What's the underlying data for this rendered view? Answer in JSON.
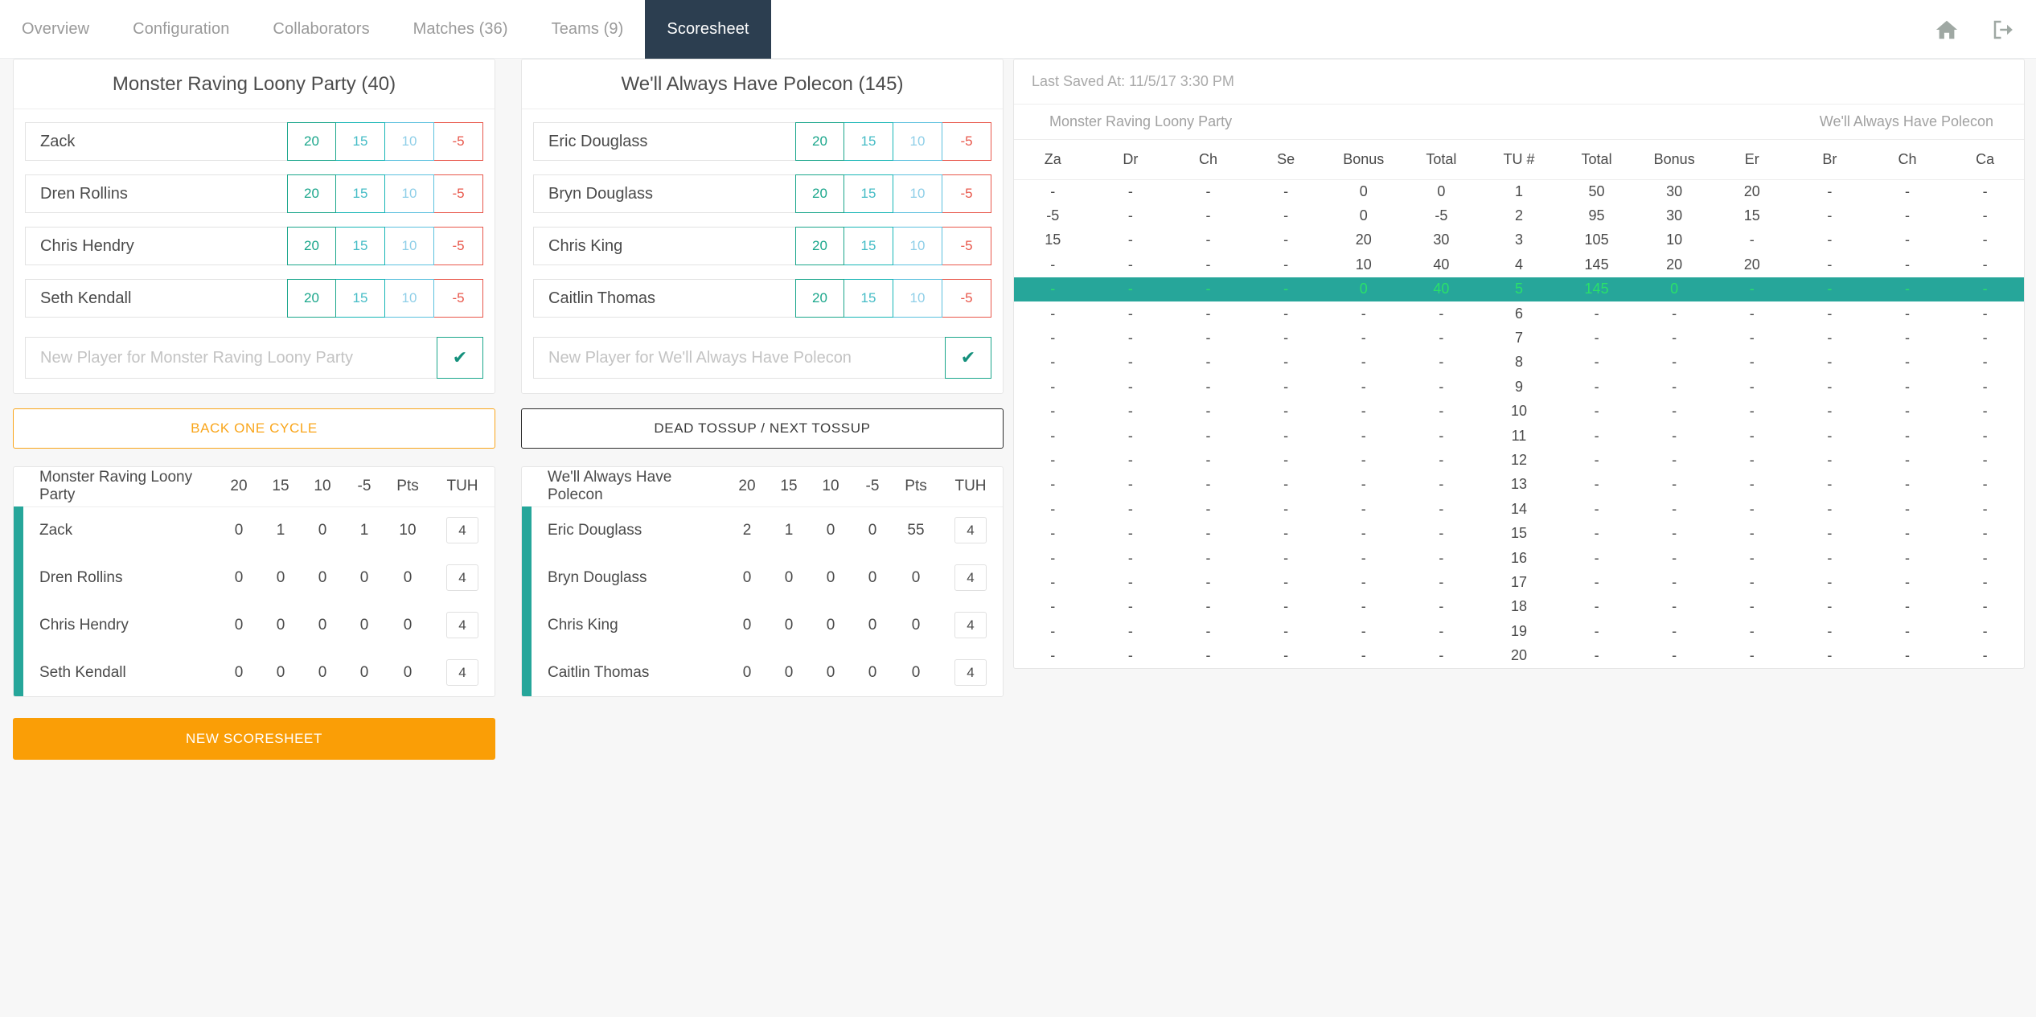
{
  "nav": {
    "tabs": [
      {
        "label": "Overview",
        "active": false
      },
      {
        "label": "Configuration",
        "active": false
      },
      {
        "label": "Collaborators",
        "active": false
      },
      {
        "label": "Matches (36)",
        "active": false
      },
      {
        "label": "Teams (9)",
        "active": false
      },
      {
        "label": "Scoresheet",
        "active": true
      }
    ],
    "icons": [
      {
        "name": "home-icon"
      },
      {
        "name": "sign-out-icon"
      }
    ]
  },
  "colors": {
    "accent_teal": "#26a69a",
    "nav_active_bg": "#2c3e50",
    "orange": "#fa9e06",
    "warning": "#f9a51a",
    "btn_20": "#1aa68b",
    "btn_15": "#45bcc6",
    "btn_10": "#8fcfe8",
    "btn_neg5": "#e8564a",
    "highlight_text": "#2ae06a"
  },
  "team_a": {
    "title": "Monster Raving Loony Party (40)",
    "name": "Monster Raving Loony Party",
    "score_buttons": [
      "20",
      "15",
      "10",
      "-5"
    ],
    "players": [
      "Zack",
      "Dren Rollins",
      "Chris Hendry",
      "Seth Kendall"
    ],
    "new_player_placeholder": "New Player for Monster Raving Loony Party",
    "confirm_icon": "check-icon",
    "action_button": "BACK ONE CYCLE",
    "stats": {
      "headers": [
        "Monster Raving Loony Party",
        "20",
        "15",
        "10",
        "-5",
        "Pts",
        "TUH"
      ],
      "rows": [
        {
          "name": "Zack",
          "c20": "0",
          "c15": "1",
          "c10": "0",
          "cneg5": "1",
          "pts": "10",
          "tuh": "4"
        },
        {
          "name": "Dren Rollins",
          "c20": "0",
          "c15": "0",
          "c10": "0",
          "cneg5": "0",
          "pts": "0",
          "tuh": "4"
        },
        {
          "name": "Chris Hendry",
          "c20": "0",
          "c15": "0",
          "c10": "0",
          "cneg5": "0",
          "pts": "0",
          "tuh": "4"
        },
        {
          "name": "Seth Kendall",
          "c20": "0",
          "c15": "0",
          "c10": "0",
          "cneg5": "0",
          "pts": "0",
          "tuh": "4"
        }
      ]
    },
    "new_scoresheet_button": "NEW SCORESHEET"
  },
  "team_b": {
    "title": "We'll Always Have Polecon (145)",
    "name": "We'll Always Have Polecon",
    "score_buttons": [
      "20",
      "15",
      "10",
      "-5"
    ],
    "players": [
      "Eric Douglass",
      "Bryn Douglass",
      "Chris King",
      "Caitlin Thomas"
    ],
    "new_player_placeholder": "New Player for We'll Always Have Polecon",
    "confirm_icon": "check-icon",
    "action_button": "DEAD TOSSUP / NEXT TOSSUP",
    "stats": {
      "headers": [
        "We'll Always Have Polecon",
        "20",
        "15",
        "10",
        "-5",
        "Pts",
        "TUH"
      ],
      "rows": [
        {
          "name": "Eric Douglass",
          "c20": "2",
          "c15": "1",
          "c10": "0",
          "cneg5": "0",
          "pts": "55",
          "tuh": "4"
        },
        {
          "name": "Bryn Douglass",
          "c20": "0",
          "c15": "0",
          "c10": "0",
          "cneg5": "0",
          "pts": "0",
          "tuh": "4"
        },
        {
          "name": "Chris King",
          "c20": "0",
          "c15": "0",
          "c10": "0",
          "cneg5": "0",
          "pts": "0",
          "tuh": "4"
        },
        {
          "name": "Caitlin Thomas",
          "c20": "0",
          "c15": "0",
          "c10": "0",
          "cneg5": "0",
          "pts": "0",
          "tuh": "4"
        }
      ]
    }
  },
  "scoresheet": {
    "last_saved_label": "Last Saved At: 11/5/17 3:30 PM",
    "team_left": "Monster Raving Loony Party",
    "team_right": "We'll Always Have Polecon",
    "headers": [
      "Za",
      "Dr",
      "Ch",
      "Se",
      "Bonus",
      "Total",
      "TU #",
      "Total",
      "Bonus",
      "Er",
      "Br",
      "Ch",
      "Ca"
    ],
    "highlight_row_index": 4,
    "rows": [
      [
        "-",
        "-",
        "-",
        "-",
        "0",
        "0",
        "1",
        "50",
        "30",
        "20",
        "-",
        "-",
        "-"
      ],
      [
        "-5",
        "-",
        "-",
        "-",
        "0",
        "-5",
        "2",
        "95",
        "30",
        "15",
        "-",
        "-",
        "-"
      ],
      [
        "15",
        "-",
        "-",
        "-",
        "20",
        "30",
        "3",
        "105",
        "10",
        "-",
        "-",
        "-",
        "-"
      ],
      [
        "-",
        "-",
        "-",
        "-",
        "10",
        "40",
        "4",
        "145",
        "20",
        "20",
        "-",
        "-",
        "-"
      ],
      [
        "-",
        "-",
        "-",
        "-",
        "0",
        "40",
        "5",
        "145",
        "0",
        "-",
        "-",
        "-",
        "-"
      ],
      [
        "-",
        "-",
        "-",
        "-",
        "-",
        "-",
        "6",
        "-",
        "-",
        "-",
        "-",
        "-",
        "-"
      ],
      [
        "-",
        "-",
        "-",
        "-",
        "-",
        "-",
        "7",
        "-",
        "-",
        "-",
        "-",
        "-",
        "-"
      ],
      [
        "-",
        "-",
        "-",
        "-",
        "-",
        "-",
        "8",
        "-",
        "-",
        "-",
        "-",
        "-",
        "-"
      ],
      [
        "-",
        "-",
        "-",
        "-",
        "-",
        "-",
        "9",
        "-",
        "-",
        "-",
        "-",
        "-",
        "-"
      ],
      [
        "-",
        "-",
        "-",
        "-",
        "-",
        "-",
        "10",
        "-",
        "-",
        "-",
        "-",
        "-",
        "-"
      ],
      [
        "-",
        "-",
        "-",
        "-",
        "-",
        "-",
        "11",
        "-",
        "-",
        "-",
        "-",
        "-",
        "-"
      ],
      [
        "-",
        "-",
        "-",
        "-",
        "-",
        "-",
        "12",
        "-",
        "-",
        "-",
        "-",
        "-",
        "-"
      ],
      [
        "-",
        "-",
        "-",
        "-",
        "-",
        "-",
        "13",
        "-",
        "-",
        "-",
        "-",
        "-",
        "-"
      ],
      [
        "-",
        "-",
        "-",
        "-",
        "-",
        "-",
        "14",
        "-",
        "-",
        "-",
        "-",
        "-",
        "-"
      ],
      [
        "-",
        "-",
        "-",
        "-",
        "-",
        "-",
        "15",
        "-",
        "-",
        "-",
        "-",
        "-",
        "-"
      ],
      [
        "-",
        "-",
        "-",
        "-",
        "-",
        "-",
        "16",
        "-",
        "-",
        "-",
        "-",
        "-",
        "-"
      ],
      [
        "-",
        "-",
        "-",
        "-",
        "-",
        "-",
        "17",
        "-",
        "-",
        "-",
        "-",
        "-",
        "-"
      ],
      [
        "-",
        "-",
        "-",
        "-",
        "-",
        "-",
        "18",
        "-",
        "-",
        "-",
        "-",
        "-",
        "-"
      ],
      [
        "-",
        "-",
        "-",
        "-",
        "-",
        "-",
        "19",
        "-",
        "-",
        "-",
        "-",
        "-",
        "-"
      ],
      [
        "-",
        "-",
        "-",
        "-",
        "-",
        "-",
        "20",
        "-",
        "-",
        "-",
        "-",
        "-",
        "-"
      ]
    ]
  }
}
